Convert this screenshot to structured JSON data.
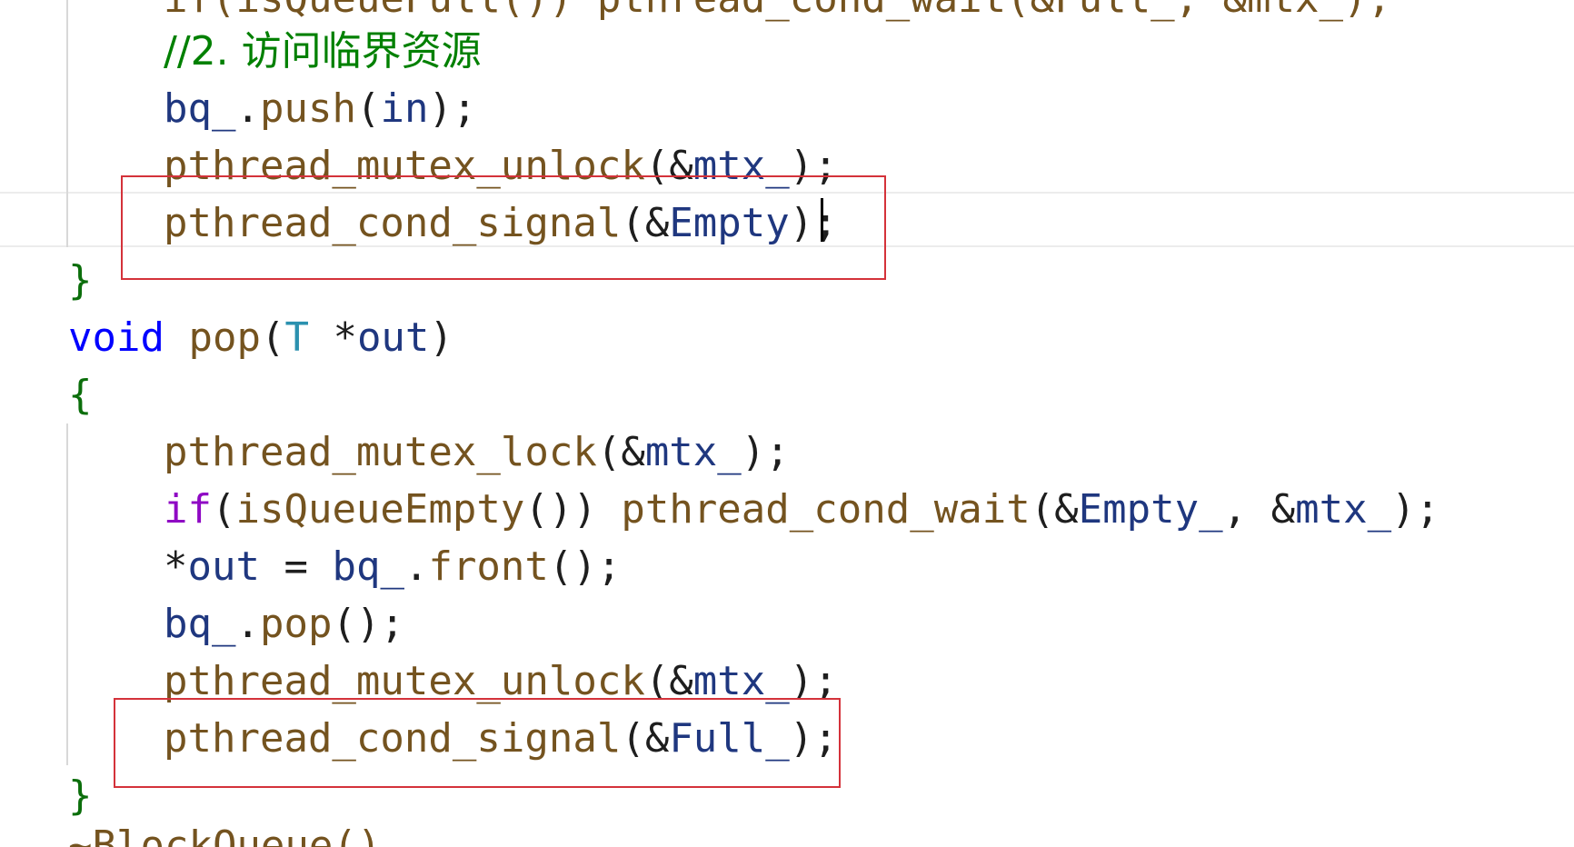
{
  "editor": {
    "lines": [
      {
        "parts": [
          {
            "t": "if(isQueueFull()) pthread_cond_wait(&Full_, &mtx_);",
            "c": "fn"
          }
        ]
      },
      {
        "parts": [
          {
            "t": "//2. 访问临界资源",
            "c": "comment"
          }
        ]
      },
      {
        "parts": [
          {
            "t": "bq_",
            "c": "var"
          },
          {
            "t": ".",
            "c": "punc"
          },
          {
            "t": "push",
            "c": "fn"
          },
          {
            "t": "(",
            "c": "punc"
          },
          {
            "t": "in",
            "c": "var"
          },
          {
            "t": ");",
            "c": "punc"
          }
        ]
      },
      {
        "parts": [
          {
            "t": "pthread_mutex_unlock",
            "c": "fn"
          },
          {
            "t": "(&",
            "c": "punc"
          },
          {
            "t": "mtx_",
            "c": "var"
          },
          {
            "t": ");",
            "c": "punc"
          }
        ]
      },
      {
        "parts": [
          {
            "t": "pthread_cond_signal",
            "c": "fn"
          },
          {
            "t": "(&",
            "c": "punc"
          },
          {
            "t": "Empty",
            "c": "var"
          },
          {
            "t": ");",
            "c": "punc"
          }
        ]
      },
      {
        "parts": [
          {
            "t": "}",
            "c": "brace"
          }
        ]
      },
      {
        "parts": [
          {
            "t": "void",
            "c": "kw"
          },
          {
            "t": " ",
            "c": "punc"
          },
          {
            "t": "pop",
            "c": "fn"
          },
          {
            "t": "(",
            "c": "punc"
          },
          {
            "t": "T",
            "c": "type"
          },
          {
            "t": " *",
            "c": "punc"
          },
          {
            "t": "out",
            "c": "var"
          },
          {
            "t": ")",
            "c": "punc"
          }
        ]
      },
      {
        "parts": [
          {
            "t": "{",
            "c": "brace"
          }
        ]
      },
      {
        "parts": [
          {
            "t": "pthread_mutex_lock",
            "c": "fn"
          },
          {
            "t": "(&",
            "c": "punc"
          },
          {
            "t": "mtx_",
            "c": "var"
          },
          {
            "t": ");",
            "c": "punc"
          }
        ]
      },
      {
        "parts": [
          {
            "t": "if",
            "c": "ctrl"
          },
          {
            "t": "(",
            "c": "punc"
          },
          {
            "t": "isQueueEmpty",
            "c": "fn"
          },
          {
            "t": "()) ",
            "c": "punc"
          },
          {
            "t": "pthread_cond_wait",
            "c": "fn"
          },
          {
            "t": "(&",
            "c": "punc"
          },
          {
            "t": "Empty_",
            "c": "var"
          },
          {
            "t": ", &",
            "c": "punc"
          },
          {
            "t": "mtx_",
            "c": "var"
          },
          {
            "t": ");",
            "c": "punc"
          }
        ]
      },
      {
        "parts": [
          {
            "t": "*",
            "c": "punc"
          },
          {
            "t": "out",
            "c": "var"
          },
          {
            "t": " = ",
            "c": "punc"
          },
          {
            "t": "bq_",
            "c": "var"
          },
          {
            "t": ".",
            "c": "punc"
          },
          {
            "t": "front",
            "c": "fn"
          },
          {
            "t": "();",
            "c": "punc"
          }
        ]
      },
      {
        "parts": [
          {
            "t": "bq_",
            "c": "var"
          },
          {
            "t": ".",
            "c": "punc"
          },
          {
            "t": "pop",
            "c": "fn"
          },
          {
            "t": "();",
            "c": "punc"
          }
        ]
      },
      {
        "parts": [
          {
            "t": "pthread_mutex_unlock",
            "c": "fn"
          },
          {
            "t": "(&",
            "c": "punc"
          },
          {
            "t": "mtx_",
            "c": "var"
          },
          {
            "t": ");",
            "c": "punc"
          }
        ]
      },
      {
        "parts": [
          {
            "t": "pthread_cond_signal",
            "c": "fn"
          },
          {
            "t": "(&",
            "c": "punc"
          },
          {
            "t": "Full_",
            "c": "var"
          },
          {
            "t": ");",
            "c": "punc"
          }
        ]
      },
      {
        "parts": [
          {
            "t": "}",
            "c": "brace"
          }
        ]
      },
      {
        "parts": [
          {
            "t": "~BlockQueue()",
            "c": "fn"
          }
        ]
      }
    ]
  },
  "colors": {
    "highlight_box": "#d4323a",
    "comment": "#008000",
    "keyword": "#0000ff",
    "function": "#74531f",
    "variable": "#1f377f"
  }
}
